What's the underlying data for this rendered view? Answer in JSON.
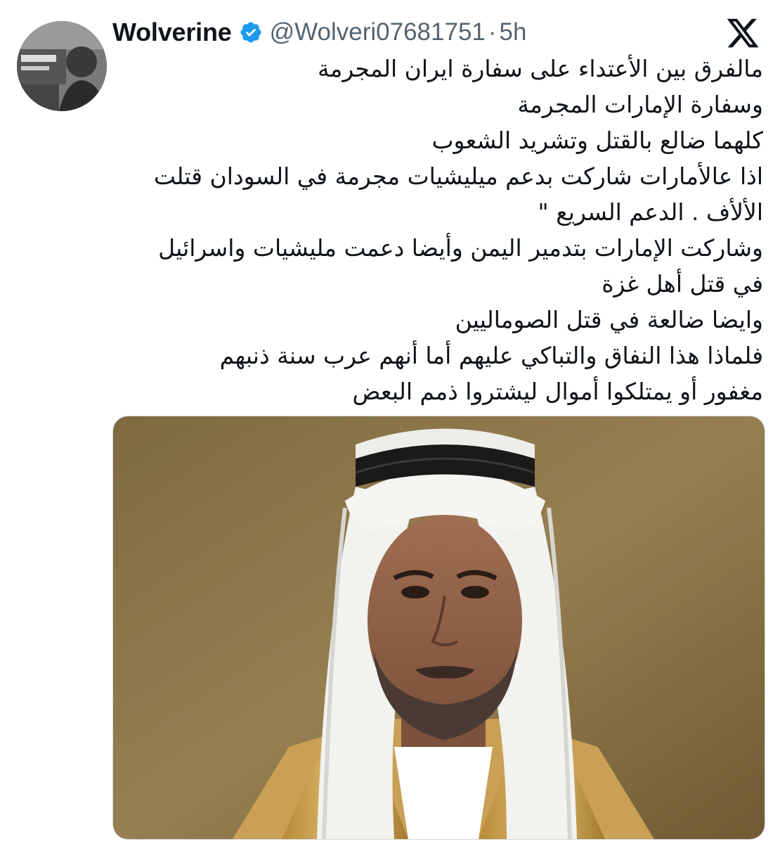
{
  "tweet": {
    "display_name": "Wolverine",
    "handle": "@Wolveri07681751",
    "separator": "·",
    "timestamp": "5h",
    "body_lines": [
      "مالفرق بين الأعتداء على سفارة ايران المجرمة",
      "وسفارة الإمارات المجرمة",
      "كلهما ضالع بالقتل وتشريد الشعوب",
      "اذا عالأمارات شاركت بدعم ميليشيات مجرمة في السودان قتلت",
      "الألأف . الدعم السريع \"",
      "وشاركت الإمارات بتدمير اليمن وأيضا دعمت مليشيات واسرائيل",
      "في قتل أهل غزة",
      "وايضا ضالعة في قتل الصوماليين",
      "فلماذا هذا النفاق والتباكي عليهم أما أنهم عرب سنة ذنبهم",
      "مغفور أو يمتلكوا أموال ليشتروا ذمم البعض"
    ]
  },
  "icons": {
    "verified": "verified-badge-icon",
    "platform": "x-logo-icon"
  },
  "colors": {
    "verified_blue": "#1d9bf0",
    "secondary_text": "#536471",
    "primary_text": "#0f1419"
  }
}
